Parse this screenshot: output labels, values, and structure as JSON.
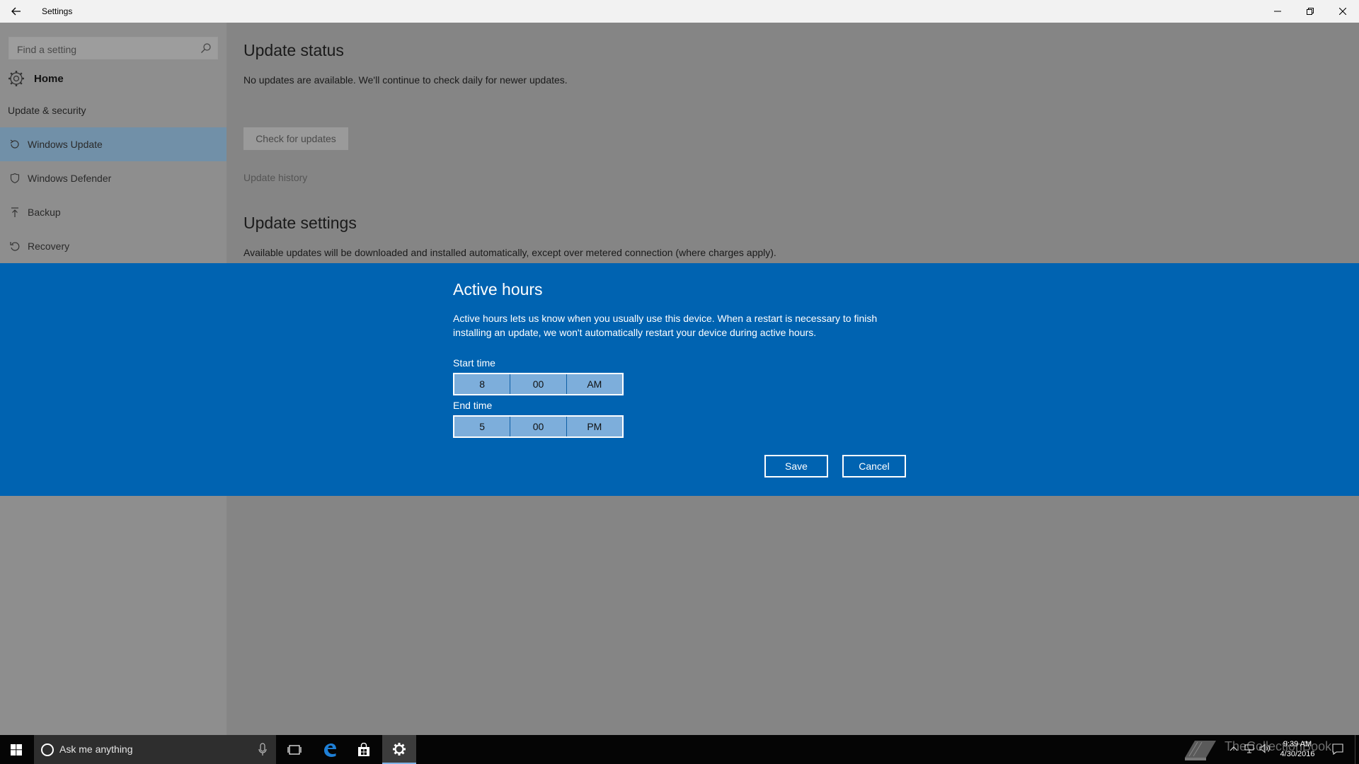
{
  "window": {
    "title": "Settings"
  },
  "sidebar": {
    "search_placeholder": "Find a setting",
    "home_label": "Home",
    "section_label": "Update & security",
    "items": [
      {
        "label": "Windows Update",
        "icon": "refresh-icon",
        "selected": true
      },
      {
        "label": "Windows Defender",
        "icon": "shield-icon",
        "selected": false
      },
      {
        "label": "Backup",
        "icon": "backup-arrow-icon",
        "selected": false
      },
      {
        "label": "Recovery",
        "icon": "recovery-icon",
        "selected": false
      }
    ]
  },
  "main": {
    "update_status_heading": "Update status",
    "update_status_text": "No updates are available. We'll continue to check daily for newer updates.",
    "check_button": "Check for updates",
    "history_link": "Update history",
    "update_settings_heading": "Update settings",
    "update_settings_text": "Available updates will be downloaded and installed automatically, except over metered connection (where charges apply)."
  },
  "dialog": {
    "title": "Active hours",
    "description": "Active hours lets us know when you usually use this device. When a restart is necessary to finish installing an update, we won't automatically restart your device during active hours.",
    "start_label": "Start time",
    "start": {
      "hour": "8",
      "minute": "00",
      "period": "AM"
    },
    "end_label": "End time",
    "end": {
      "hour": "5",
      "minute": "00",
      "period": "PM"
    },
    "save": "Save",
    "cancel": "Cancel",
    "accent_color": "#0063b1"
  },
  "taskbar": {
    "search_placeholder": "Ask me anything",
    "watermark": "TheCollectionBook",
    "time": "9:39 AM",
    "date": "4/30/2016"
  }
}
